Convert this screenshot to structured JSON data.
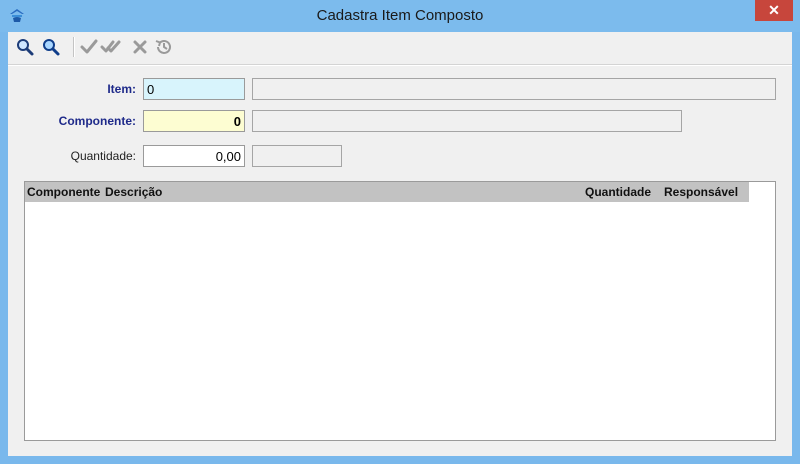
{
  "window": {
    "title": "Cadastra Item Composto",
    "close_glyph": "✕"
  },
  "toolbar": {
    "buttons": [
      {
        "name": "search-icon",
        "enabled": true
      },
      {
        "name": "search-alt-icon",
        "enabled": true
      },
      {
        "name": "confirm-check-icon",
        "enabled": false
      },
      {
        "name": "confirm-all-check-icon",
        "enabled": false
      },
      {
        "name": "cancel-x-icon",
        "enabled": false
      },
      {
        "name": "history-icon",
        "enabled": false
      }
    ]
  },
  "form": {
    "item_label": "Item:",
    "item_value": "0",
    "item_desc_value": "",
    "componente_label": "Componente:",
    "componente_value": "0",
    "componente_desc_value": "",
    "quantidade_label": "Quantidade:",
    "quantidade_value": "0,00",
    "quantidade_extra_value": ""
  },
  "grid": {
    "columns": [
      "Componente",
      "Descrição",
      "Quantidade",
      "Responsável"
    ],
    "rows": []
  },
  "colors": {
    "item_field_bg": "#d8f4fc",
    "componente_field_bg": "#fdfdd2",
    "header_bg": "#c2c2c2",
    "label_accent": "#1e2a8a"
  }
}
